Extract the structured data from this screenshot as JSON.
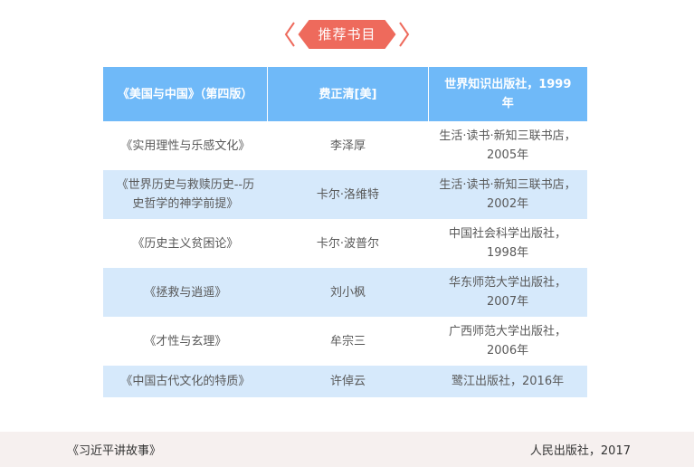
{
  "header": {
    "title": "推荐书目"
  },
  "colors": {
    "accent": "#ee6a5c",
    "table_header": "#6fb9f8",
    "row_alt": "#d6e9fb",
    "footer_bg": "#f6f0ef"
  },
  "table": {
    "header": [
      "《美国与中国》（第四版）",
      "费正清[美]",
      "世界知识出版社，1999年"
    ],
    "rows": [
      [
        "《实用理性与乐感文化》",
        "李泽厚",
        "生活·读书·新知三联书店，2005年"
      ],
      [
        "《世界历史与救赎历史--历史哲学的神学前提》",
        "卡尔·洛维特",
        "生活·读书·新知三联书店，2002年"
      ],
      [
        "《历史主义贫困论》",
        "卡尔·波普尔",
        "中国社会科学出版社，1998年"
      ],
      [
        "《拯救与逍遥》",
        "刘小枫",
        "华东师范大学出版社，2007年"
      ],
      [
        "《才性与玄理》",
        "牟宗三",
        "广西师范大学出版社，2006年"
      ],
      [
        "《中国古代文化的特质》",
        "许倬云",
        "鹭江出版社，2016年"
      ]
    ]
  },
  "footer": {
    "left": "《习近平讲故事》",
    "right": "人民出版社，2017"
  }
}
